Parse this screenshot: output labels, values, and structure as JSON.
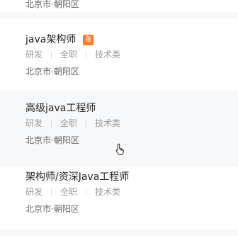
{
  "top_location": "北京市·朝阳区",
  "jobs": [
    {
      "title": "java架构师",
      "badge": "急",
      "tags": [
        "研发",
        "全职",
        "技术类"
      ],
      "location": "北京市·朝阳区"
    },
    {
      "title": "高级java工程师",
      "tags": [
        "研发",
        "全职",
        "技术类"
      ],
      "location": "北京市·朝阳区"
    },
    {
      "title": "架构师/资深Java工程师",
      "tags": [
        "研发",
        "全职",
        "技术类"
      ],
      "location": "北京市·朝阳区"
    }
  ],
  "colors": {
    "badge": "#ff7d22",
    "divider": "#f7f8fa",
    "hover_background": "#f7f8fa"
  },
  "icons": {
    "cursor": "hand-pointer-icon"
  }
}
